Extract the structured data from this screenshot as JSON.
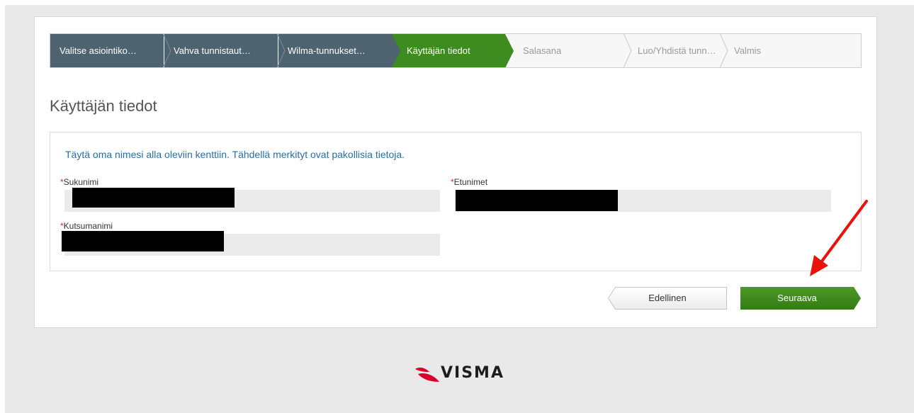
{
  "wizard": {
    "steps": [
      {
        "label": "Valitse asiointiko…",
        "state": "done"
      },
      {
        "label": "Vahva tunnistaut…",
        "state": "done"
      },
      {
        "label": "Wilma-tunnukset…",
        "state": "done"
      },
      {
        "label": "Käyttäjän tiedot",
        "state": "current"
      },
      {
        "label": "Salasana",
        "state": "todo"
      },
      {
        "label": "Luo/Yhdistä tunn…",
        "state": "todo"
      },
      {
        "label": "Valmis",
        "state": "todo"
      }
    ]
  },
  "page": {
    "title": "Käyttäjän tiedot",
    "instruction": "Täytä oma nimesi alla oleviin kenttiin. Tähdellä merkityt ovat pakollisia tietoja."
  },
  "form": {
    "required_marker": "*",
    "surname_label": "Sukunimi",
    "firstnames_label": "Etunimet",
    "nickname_label": "Kutsumanimi"
  },
  "buttons": {
    "previous": "Edellinen",
    "next": "Seuraava"
  },
  "footer": {
    "logo_text": "VISMA"
  },
  "colors": {
    "done_step": "#4e6370",
    "current_step": "#3e8b1f",
    "next_button": "#3e8b1f",
    "instruction_text": "#2c6e9f",
    "annotation_arrow": "#e8140c",
    "logo_red": "#d6002a"
  }
}
